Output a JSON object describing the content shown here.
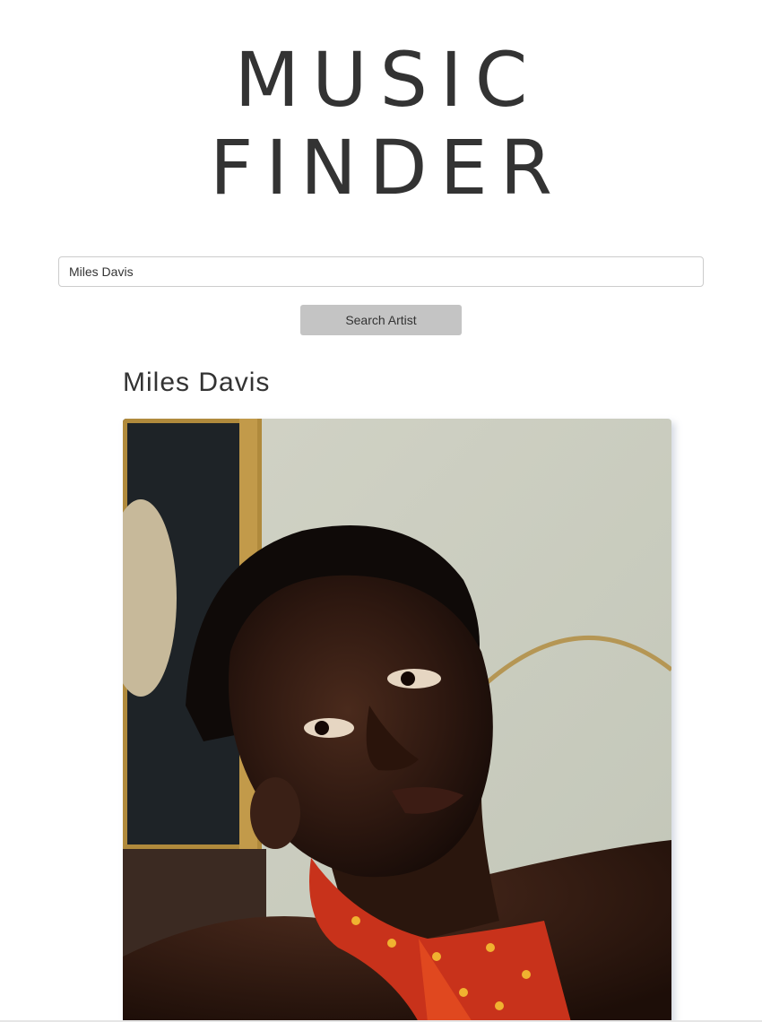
{
  "header": {
    "title_line1": "MUSIC",
    "title_line2": "FINDER"
  },
  "search": {
    "value": "Miles Davis",
    "button_label": "Search Artist"
  },
  "result": {
    "artist_name": "Miles Davis",
    "photo_subject": "portrait of the artist"
  }
}
